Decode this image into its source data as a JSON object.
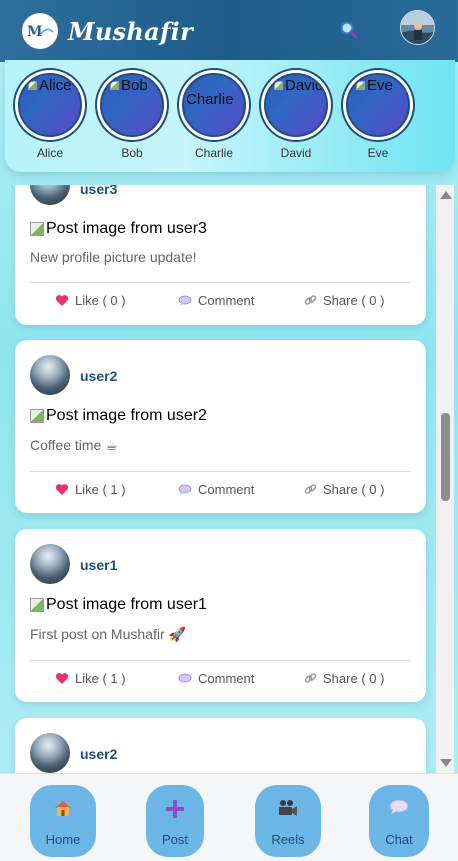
{
  "app": {
    "title": "Mushafir",
    "logo_text": "Mushafir"
  },
  "header": {
    "brand": "Mushafir",
    "search_icon": "search-icon",
    "avatar_icon": "profile-avatar"
  },
  "stories": [
    {
      "name": "Alice",
      "alt": "Alice"
    },
    {
      "name": "Bob",
      "alt": "Bob"
    },
    {
      "name": "Charlie",
      "alt": "Charlie"
    },
    {
      "name": "David",
      "alt": "David"
    },
    {
      "name": "Eve",
      "alt": "Eve"
    }
  ],
  "posts": [
    {
      "username": "user3",
      "image_alt": "Post image from user3",
      "caption": "New profile picture update!",
      "like_label": "Like",
      "likes": "0",
      "comment_label": "Comment",
      "share_label": "Share",
      "shares": "0"
    },
    {
      "username": "user2",
      "image_alt": "Post image from user2",
      "caption": "Coffee time ☕",
      "like_label": "Like",
      "likes": "1",
      "comment_label": "Comment",
      "share_label": "Share",
      "shares": "0"
    },
    {
      "username": "user1",
      "image_alt": "Post image from user1",
      "caption": "First post on Mushafir 🚀",
      "like_label": "Like",
      "likes": "1",
      "comment_label": "Comment",
      "share_label": "Share",
      "shares": "0"
    },
    {
      "username": "user2"
    }
  ],
  "nav": {
    "home": "Home",
    "post": "Post",
    "reels": "Reels",
    "chat": "Chat"
  },
  "colors": {
    "header_bg": "#1e5c8a",
    "accent": "#1f4f7a",
    "nav_button": "#6bb6e5",
    "like_heart": "#e8336b"
  }
}
